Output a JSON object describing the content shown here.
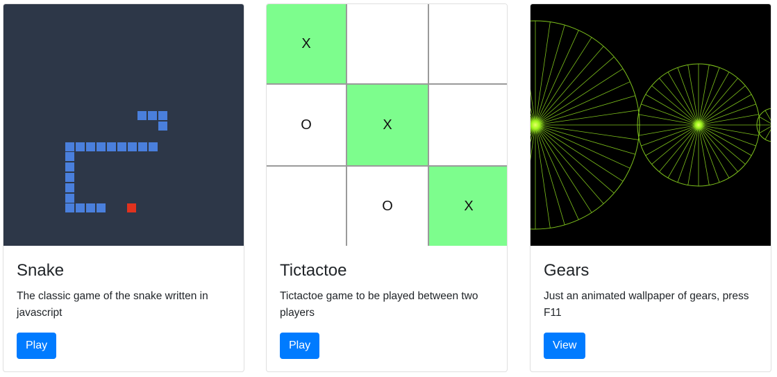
{
  "cards": [
    {
      "title": "Snake",
      "description": "The classic game of the snake written in javascript",
      "button": "Play"
    },
    {
      "title": "Tictactoe",
      "description": "Tictactoe game to be played between two players",
      "button": "Play"
    },
    {
      "title": "Gears",
      "description": "Just an animated wallpaper of gears, press F11",
      "button": "View"
    }
  ],
  "snake": {
    "background": "#2d3748",
    "snake_color": "#4a7fdc",
    "food_color": "#e0321e"
  },
  "tictactoe": {
    "board": [
      "X",
      "",
      "",
      "O",
      "X",
      "",
      "",
      "O",
      "X"
    ],
    "highlight_color": "#7dfd8d",
    "highlight": [
      0,
      4,
      8
    ]
  },
  "gears": {
    "background": "#000000",
    "line_color": "#7fc31c"
  }
}
